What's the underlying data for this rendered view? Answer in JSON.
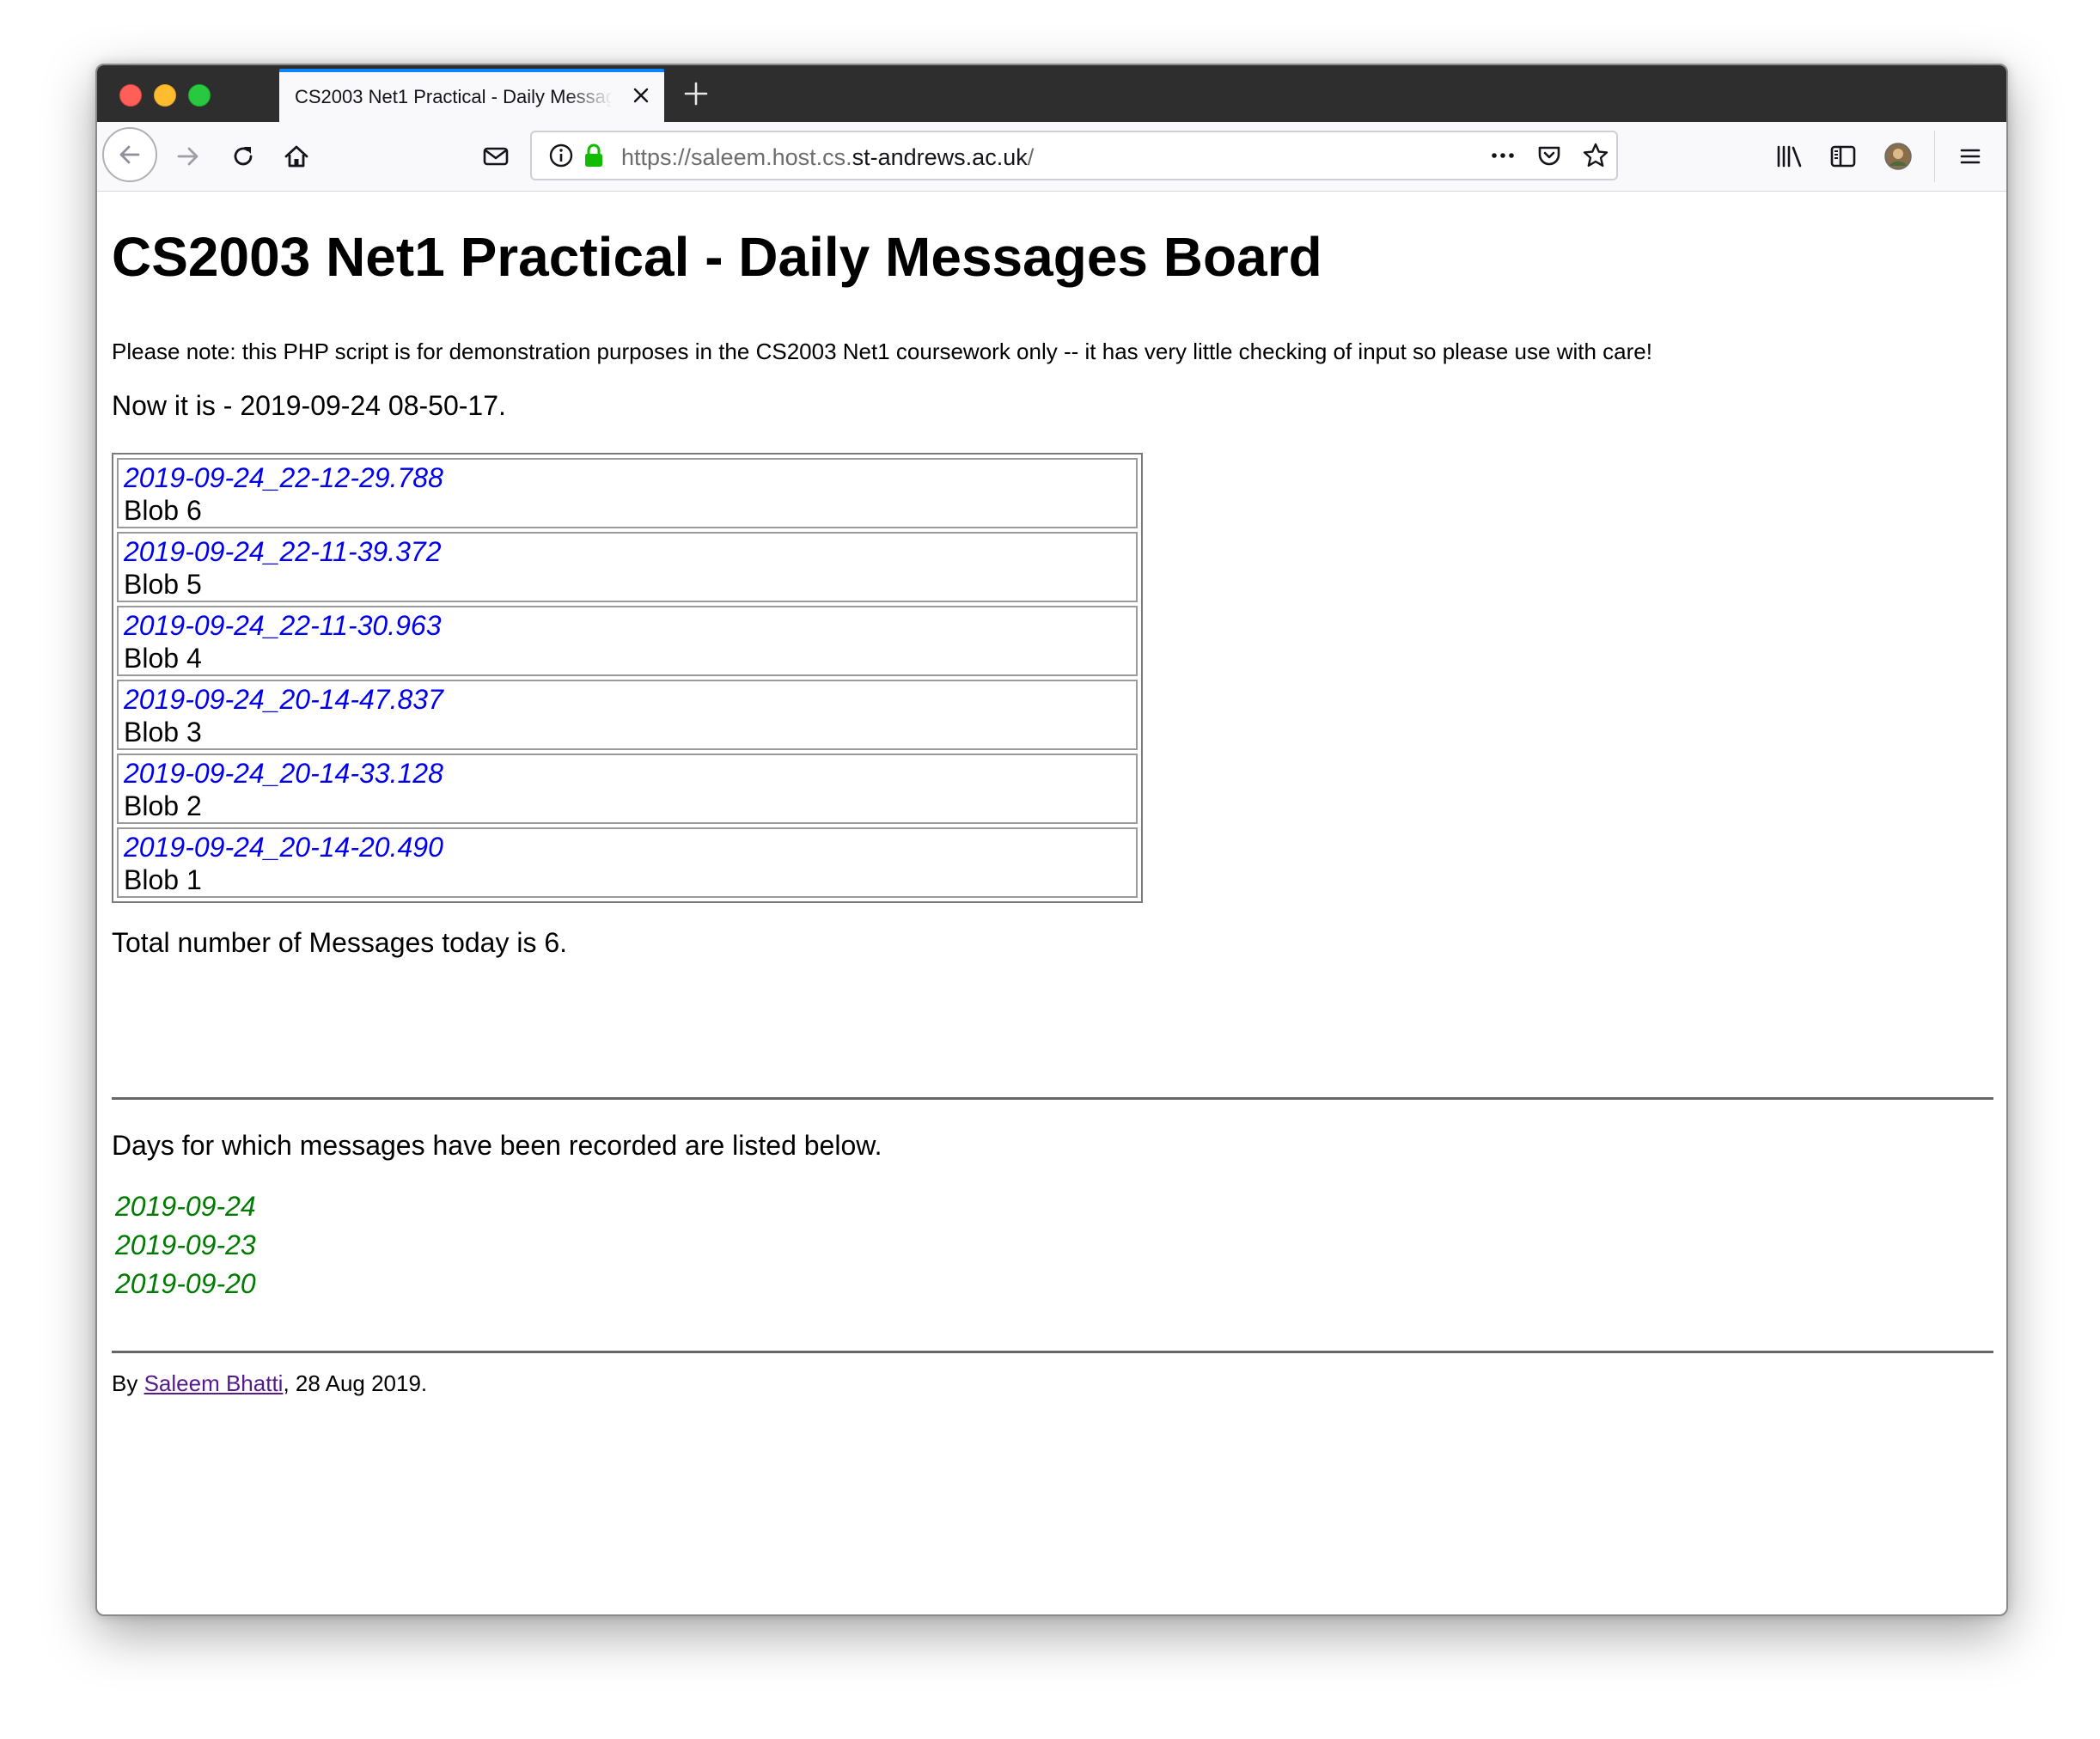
{
  "browser": {
    "tab_title": "CS2003 Net1 Practical - Daily Messages Board",
    "url_prefix": "https://saleem.host.cs.",
    "url_domain": "st-andrews.ac.uk",
    "url_suffix": "/"
  },
  "page": {
    "title": "CS2003 Net1 Practical - Daily Messages Board",
    "note": "Please note: this PHP script is for demonstration purposes in the CS2003 Net1 coursework only -- it has very little checking of input so please use with care!",
    "now": "Now it is - 2019-09-24 08-50-17.",
    "messages": [
      {
        "stamp": "2019-09-24_22-12-29.788",
        "text": "Blob 6"
      },
      {
        "stamp": "2019-09-24_22-11-39.372",
        "text": "Blob 5"
      },
      {
        "stamp": "2019-09-24_22-11-30.963",
        "text": "Blob 4"
      },
      {
        "stamp": "2019-09-24_20-14-47.837",
        "text": "Blob 3"
      },
      {
        "stamp": "2019-09-24_20-14-33.128",
        "text": "Blob 2"
      },
      {
        "stamp": "2019-09-24_20-14-20.490",
        "text": "Blob 1"
      }
    ],
    "total": "Total number of Messages today is 6.",
    "days_intro": "Days for which messages have been recorded are listed below.",
    "days": [
      "2019-09-24",
      "2019-09-23",
      "2019-09-20"
    ],
    "footer_by": "By ",
    "footer_author": "Saleem Bhatti",
    "footer_date": ", 28 Aug 2019."
  },
  "colors": {
    "timestamp": "#0000ee",
    "day_link": "#007a00",
    "author_link": "#551a8b",
    "tab_accent": "#0a84ff",
    "lock": "#12bc00"
  }
}
